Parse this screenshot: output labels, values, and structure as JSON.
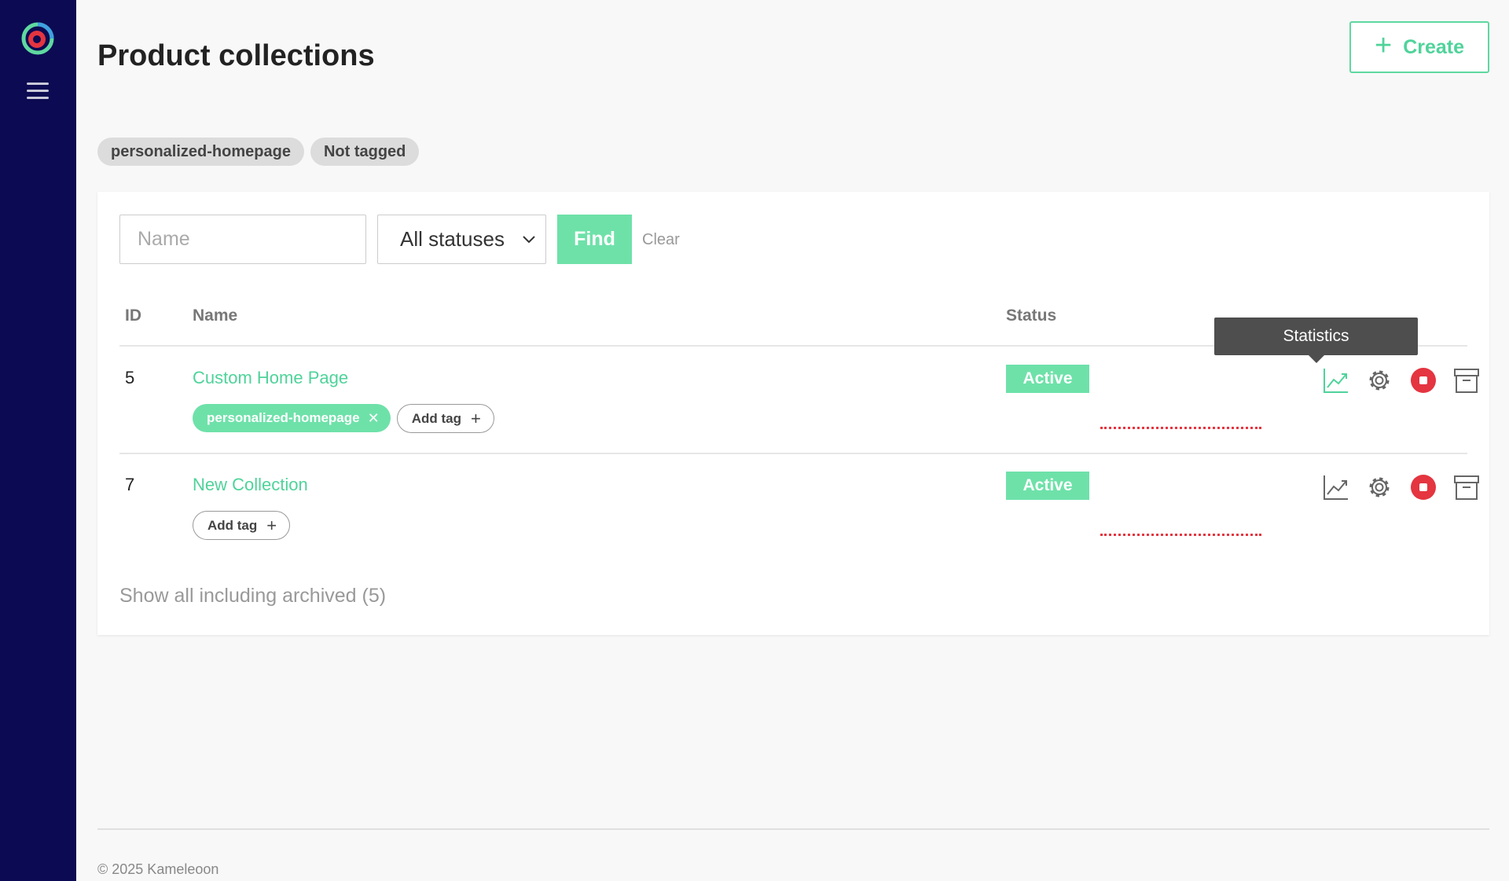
{
  "sidebar": {
    "logo_icon": "kameleoon-logo-icon",
    "menu_icon": "hamburger-menu-icon"
  },
  "header": {
    "title": "Product collections",
    "create_label": "Create",
    "create_icon": "plus-icon"
  },
  "filter_tags": [
    "personalized-homepage",
    "Not tagged"
  ],
  "search": {
    "name_placeholder": "Name",
    "status_value": "All statuses",
    "find_label": "Find",
    "clear_label": "Clear"
  },
  "table": {
    "columns": {
      "id": "ID",
      "name": "Name",
      "status": "Status"
    },
    "rows": [
      {
        "id": "5",
        "name": "Custom Home Page",
        "tags": [
          "personalized-homepage"
        ],
        "add_tag_label": "Add tag",
        "status": "Active"
      },
      {
        "id": "7",
        "name": "New Collection",
        "tags": [],
        "add_tag_label": "Add tag",
        "status": "Active"
      }
    ],
    "actions": [
      "statistics-icon",
      "settings-gear-icon",
      "stop-icon",
      "archive-icon"
    ]
  },
  "tooltip": {
    "text": "Statistics"
  },
  "show_all_label": "Show all including archived (5)",
  "footer": {
    "copyright": "© 2025 Kameleoon"
  },
  "colors": {
    "sidebar": "#0c0a52",
    "accent": "#6ee1a9",
    "accent_text": "#4fd39a",
    "danger": "#e43540"
  }
}
